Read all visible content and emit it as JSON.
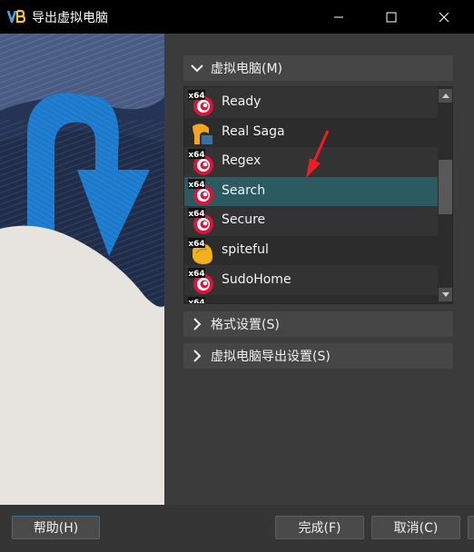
{
  "window": {
    "title": "导出虚拟电脑",
    "minimize_icon": "minimize-icon",
    "maximize_icon": "maximize-icon",
    "close_icon": "close-icon"
  },
  "sections": {
    "virtual_machines": {
      "label": "虚拟电脑(M)",
      "expanded": true
    },
    "format_settings": {
      "label": "格式设置(S)",
      "expanded": false
    },
    "export_settings": {
      "label": "虚拟电脑导出设置(S)",
      "expanded": false
    }
  },
  "vm_list": {
    "items": [
      {
        "name": "Ready",
        "os_badge": "x64",
        "icon": "debian-swirl-icon",
        "selected": false
      },
      {
        "name": "Real Saga",
        "os_badge": "",
        "icon": "unknown-os-icon",
        "selected": false
      },
      {
        "name": "Regex",
        "os_badge": "x64",
        "icon": "debian-swirl-icon",
        "selected": false
      },
      {
        "name": "Search",
        "os_badge": "x64",
        "icon": "debian-swirl-icon",
        "selected": true
      },
      {
        "name": "Secure",
        "os_badge": "x64",
        "icon": "debian-swirl-icon",
        "selected": false
      },
      {
        "name": "spiteful",
        "os_badge": "x64",
        "icon": "linux-tux-icon",
        "selected": false
      },
      {
        "name": "SudoHome",
        "os_badge": "x64",
        "icon": "debian-swirl-icon",
        "selected": false
      }
    ],
    "annotation": "red-arrow-pointer"
  },
  "footer": {
    "help_label": "帮助(H)",
    "finish_label": "完成(F)",
    "cancel_label": "取消(C)"
  },
  "colors": {
    "selection": "#2b5a61",
    "title_bar": "#000000",
    "background": "#3b3b3b",
    "row_alt": "#2c2c2c",
    "accent_arrow": "#ee1c24"
  }
}
